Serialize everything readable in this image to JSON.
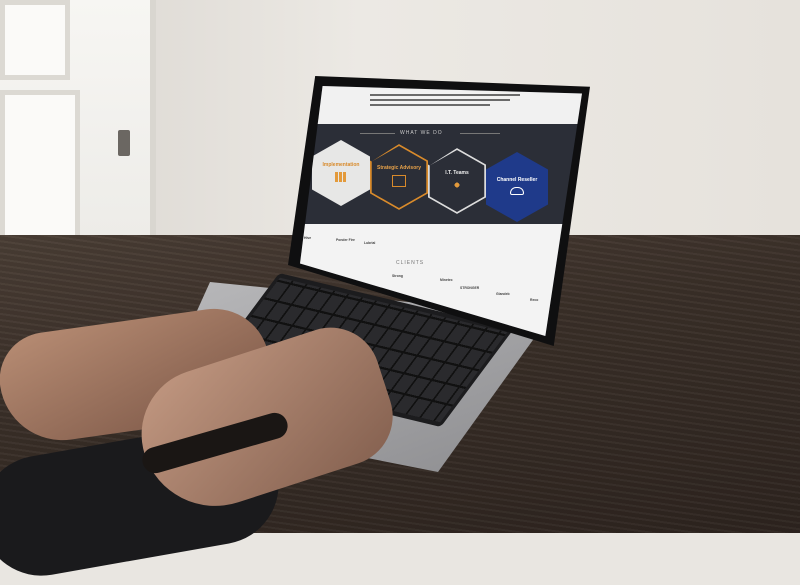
{
  "scene": {
    "description_tags": [
      "wall",
      "window",
      "wooden-table",
      "laptop",
      "hands"
    ]
  },
  "website": {
    "section_title": "WHAT WE DO",
    "services": [
      {
        "title": "Implementation",
        "subtitle": "",
        "color": "#e7e7e6"
      },
      {
        "title": "Strategic Advisory",
        "subtitle": "",
        "color": "#d88a2b"
      },
      {
        "title": "I.T. Teams",
        "subtitle": "",
        "color": "#dcdcdc"
      },
      {
        "title": "Channel Reseller",
        "subtitle": "",
        "color": "#1f3a8a"
      }
    ],
    "clients_title": "CLIENTS",
    "client_logos": [
      "Hive",
      "Ponder Fire",
      "Lubrial",
      "Strong",
      "Minetec",
      "STRONGER",
      "Glandeb",
      "Reco"
    ]
  }
}
